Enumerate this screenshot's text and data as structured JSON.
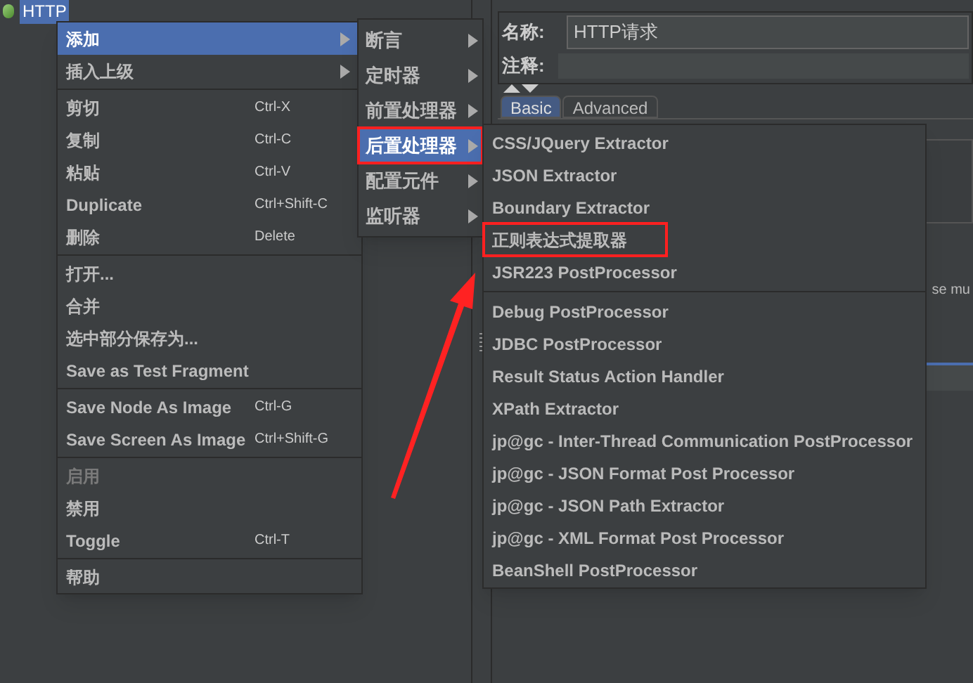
{
  "tree": {
    "items": [
      {
        "label": "HTTP",
        "selected": true
      }
    ]
  },
  "editor": {
    "name_label": "名称:",
    "name_value": "HTTP请求",
    "comment_label": "注释:",
    "tabs": [
      {
        "label": "Basic",
        "selected": true
      },
      {
        "label": "Advanced",
        "selected": false
      }
    ],
    "partial_text": "se mu"
  },
  "context_menu": {
    "groups": [
      [
        {
          "label": "添加",
          "submenu": true,
          "selected": true,
          "disabled": false
        },
        {
          "label": "插入上级",
          "submenu": true,
          "selected": false,
          "disabled": false
        }
      ],
      [
        {
          "label": "剪切",
          "shortcut": "Ctrl-X",
          "selected": false,
          "disabled": false
        },
        {
          "label": "复制",
          "shortcut": "Ctrl-C",
          "selected": false,
          "disabled": false
        },
        {
          "label": "粘贴",
          "shortcut": "Ctrl-V",
          "selected": false,
          "disabled": false
        },
        {
          "label": "Duplicate",
          "shortcut": "Ctrl+Shift-C",
          "selected": false,
          "disabled": false
        },
        {
          "label": "删除",
          "shortcut": "Delete",
          "selected": false,
          "disabled": false
        }
      ],
      [
        {
          "label": "打开...",
          "selected": false,
          "disabled": false
        },
        {
          "label": "合并",
          "selected": false,
          "disabled": false
        },
        {
          "label": "选中部分保存为...",
          "selected": false,
          "disabled": false
        },
        {
          "label": "Save as Test Fragment",
          "selected": false,
          "disabled": false
        }
      ],
      [
        {
          "label": "Save Node As Image",
          "shortcut": "Ctrl-G",
          "selected": false,
          "disabled": false
        },
        {
          "label": "Save Screen As Image",
          "shortcut": "Ctrl+Shift-G",
          "selected": false,
          "disabled": false
        }
      ],
      [
        {
          "label": "启用",
          "selected": false,
          "disabled": true
        },
        {
          "label": "禁用",
          "selected": false,
          "disabled": false
        },
        {
          "label": "Toggle",
          "shortcut": "Ctrl-T",
          "selected": false,
          "disabled": false
        }
      ],
      [
        {
          "label": "帮助",
          "selected": false,
          "disabled": false
        }
      ]
    ]
  },
  "add_submenu": {
    "items": [
      {
        "label": "断言",
        "selected": false,
        "annotated": false
      },
      {
        "label": "定时器",
        "selected": false,
        "annotated": false
      },
      {
        "label": "前置处理器",
        "selected": false,
        "annotated": false
      },
      {
        "label": "后置处理器",
        "selected": true,
        "annotated": true
      },
      {
        "label": "配置元件",
        "selected": false,
        "annotated": false
      },
      {
        "label": "监听器",
        "selected": false,
        "annotated": false
      }
    ]
  },
  "post_processor_submenu": {
    "groups": [
      [
        {
          "label": "CSS/JQuery Extractor",
          "annotated": false
        },
        {
          "label": "JSON Extractor",
          "annotated": false
        },
        {
          "label": "Boundary Extractor",
          "annotated": false
        },
        {
          "label": "正则表达式提取器",
          "annotated": true
        },
        {
          "label": "JSR223 PostProcessor",
          "annotated": false
        }
      ],
      [
        {
          "label": "Debug PostProcessor",
          "annotated": false
        },
        {
          "label": "JDBC PostProcessor",
          "annotated": false
        },
        {
          "label": "Result Status Action Handler",
          "annotated": false
        },
        {
          "label": "XPath Extractor",
          "annotated": false
        },
        {
          "label": "jp@gc - Inter-Thread Communication PostProcessor",
          "annotated": false
        },
        {
          "label": "jp@gc - JSON Format Post Processor",
          "annotated": false
        },
        {
          "label": "jp@gc - JSON Path Extractor",
          "annotated": false
        },
        {
          "label": "jp@gc - XML Format Post Processor",
          "annotated": false
        },
        {
          "label": "BeanShell PostProcessor",
          "annotated": false
        }
      ]
    ]
  }
}
